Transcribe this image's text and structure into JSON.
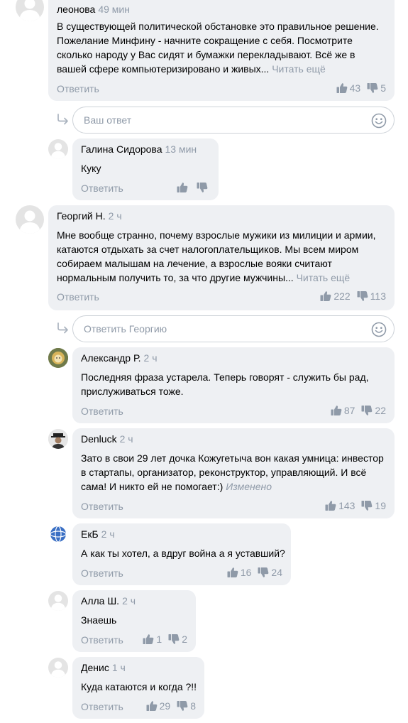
{
  "reply_label": "Ответить",
  "read_more": "Читать ещё",
  "edited_label": "Изменено",
  "comments": [
    {
      "author": "леонова",
      "time": "49 мин",
      "lines": [
        "В существующей политической обстановке это правильное решение.",
        "Пожелание Минфину - начните сокращение с себя. Посмотрите",
        "сколько народу у Вас сидят и бумажки перекладывают. Всё же в",
        "вашей сфере компьютеризировано и живых..."
      ],
      "likes": "43",
      "dislikes": "5"
    },
    {
      "author": "Галина Сидорова",
      "time": "13 мин",
      "lines": [
        "Куку"
      ],
      "likes": "",
      "dislikes": ""
    },
    {
      "author": "Георгий Н.",
      "time": "2 ч",
      "lines": [
        "Мне вообще странно, почему взрослые мужики из милиции и армии,",
        "катаются отдыхать за счет налогоплательщиков. Мы всем миром",
        "собираем малышам на лечение, а взрослые вояки считают",
        "нормальным получить то, за что другие мужчины..."
      ],
      "likes": "222",
      "dislikes": "113"
    },
    {
      "author": "Александр Р.",
      "time": "2 ч",
      "lines": [
        "Последняя фраза устарела. Теперь говорят - служить бы рад,",
        "прислуживаться тоже."
      ],
      "likes": "87",
      "dislikes": "22"
    },
    {
      "author": "Denluck",
      "time": "2 ч",
      "lines": [
        "Зато в свои 29 лет дочка Кожугетыча вон какая умница: инвестор",
        "в стартапы, организатор, реконструктор, управляющий. И всё",
        "сама! И никто ей не помогает:)"
      ],
      "likes": "143",
      "dislikes": "19"
    },
    {
      "author": "ЕкБ",
      "time": "2 ч",
      "lines": [
        "А как ты хотел, а вдруг война а я уставший?"
      ],
      "likes": "16",
      "dislikes": "24"
    },
    {
      "author": "Алла Ш.",
      "time": "2 ч",
      "lines": [
        "Знаешь"
      ],
      "likes": "1",
      "dislikes": "2"
    },
    {
      "author": "Денис",
      "time": "1 ч",
      "lines": [
        "Куда катаются и когда ?!!"
      ],
      "likes": "29",
      "dislikes": "8"
    }
  ],
  "reply_boxes": [
    {
      "placeholder": "Ваш ответ"
    },
    {
      "placeholder": "Ответить Георгию"
    }
  ],
  "icons": {
    "avatar": "user-avatar",
    "like": "thumbs-up-icon",
    "dislike": "thumbs-down-icon",
    "smile": "smile-icon",
    "reply_arrow": "reply-arrow-icon"
  },
  "colors": {
    "bubble": "#eef0f3",
    "muted": "#8f9aa8",
    "border": "#cdd2d8"
  }
}
